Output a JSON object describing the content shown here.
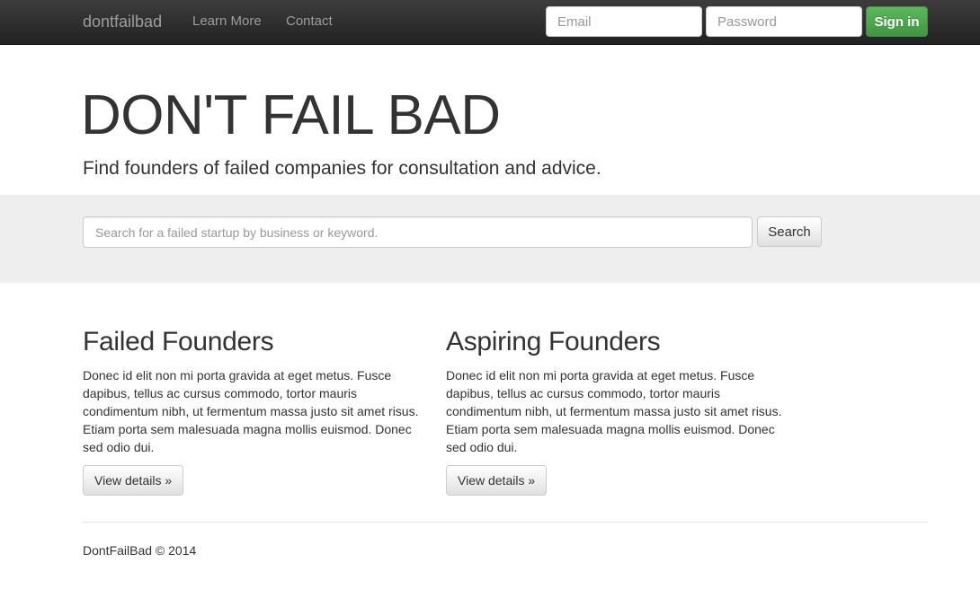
{
  "navbar": {
    "brand": "dontfailbad",
    "links": [
      "Learn More",
      "Contact"
    ],
    "email_placeholder": "Email",
    "password_placeholder": "Password",
    "signin_label": "Sign in"
  },
  "hero": {
    "title": "DON'T FAIL BAD",
    "subtitle": "Find founders of failed companies for consultation and advice."
  },
  "search": {
    "placeholder": "Search for a failed startup by business or keyword.",
    "button_label": "Search"
  },
  "columns": [
    {
      "heading": "Failed Founders",
      "body": "Donec id elit non mi porta gravida at eget metus. Fusce dapibus, tellus ac cursus commodo, tortor mauris condimentum nibh, ut fermentum massa justo sit amet risus. Etiam porta sem malesuada magna mollis euismod. Donec sed odio dui.",
      "button_label": "View details »"
    },
    {
      "heading": "Aspiring Founders",
      "body": "Donec id elit non mi porta gravida at eget metus. Fusce dapibus, tellus ac cursus commodo, tortor mauris condimentum nibh, ut fermentum massa justo sit amet risus. Etiam porta sem malesuada magna mollis euismod. Donec sed odio dui.",
      "button_label": "View details »"
    }
  ],
  "footer": {
    "text": "DontFailBad © 2014"
  },
  "colors": {
    "navbar_bg": "#222222",
    "signin_green": "#5cb85c",
    "search_band_bg": "#eeeeee"
  }
}
